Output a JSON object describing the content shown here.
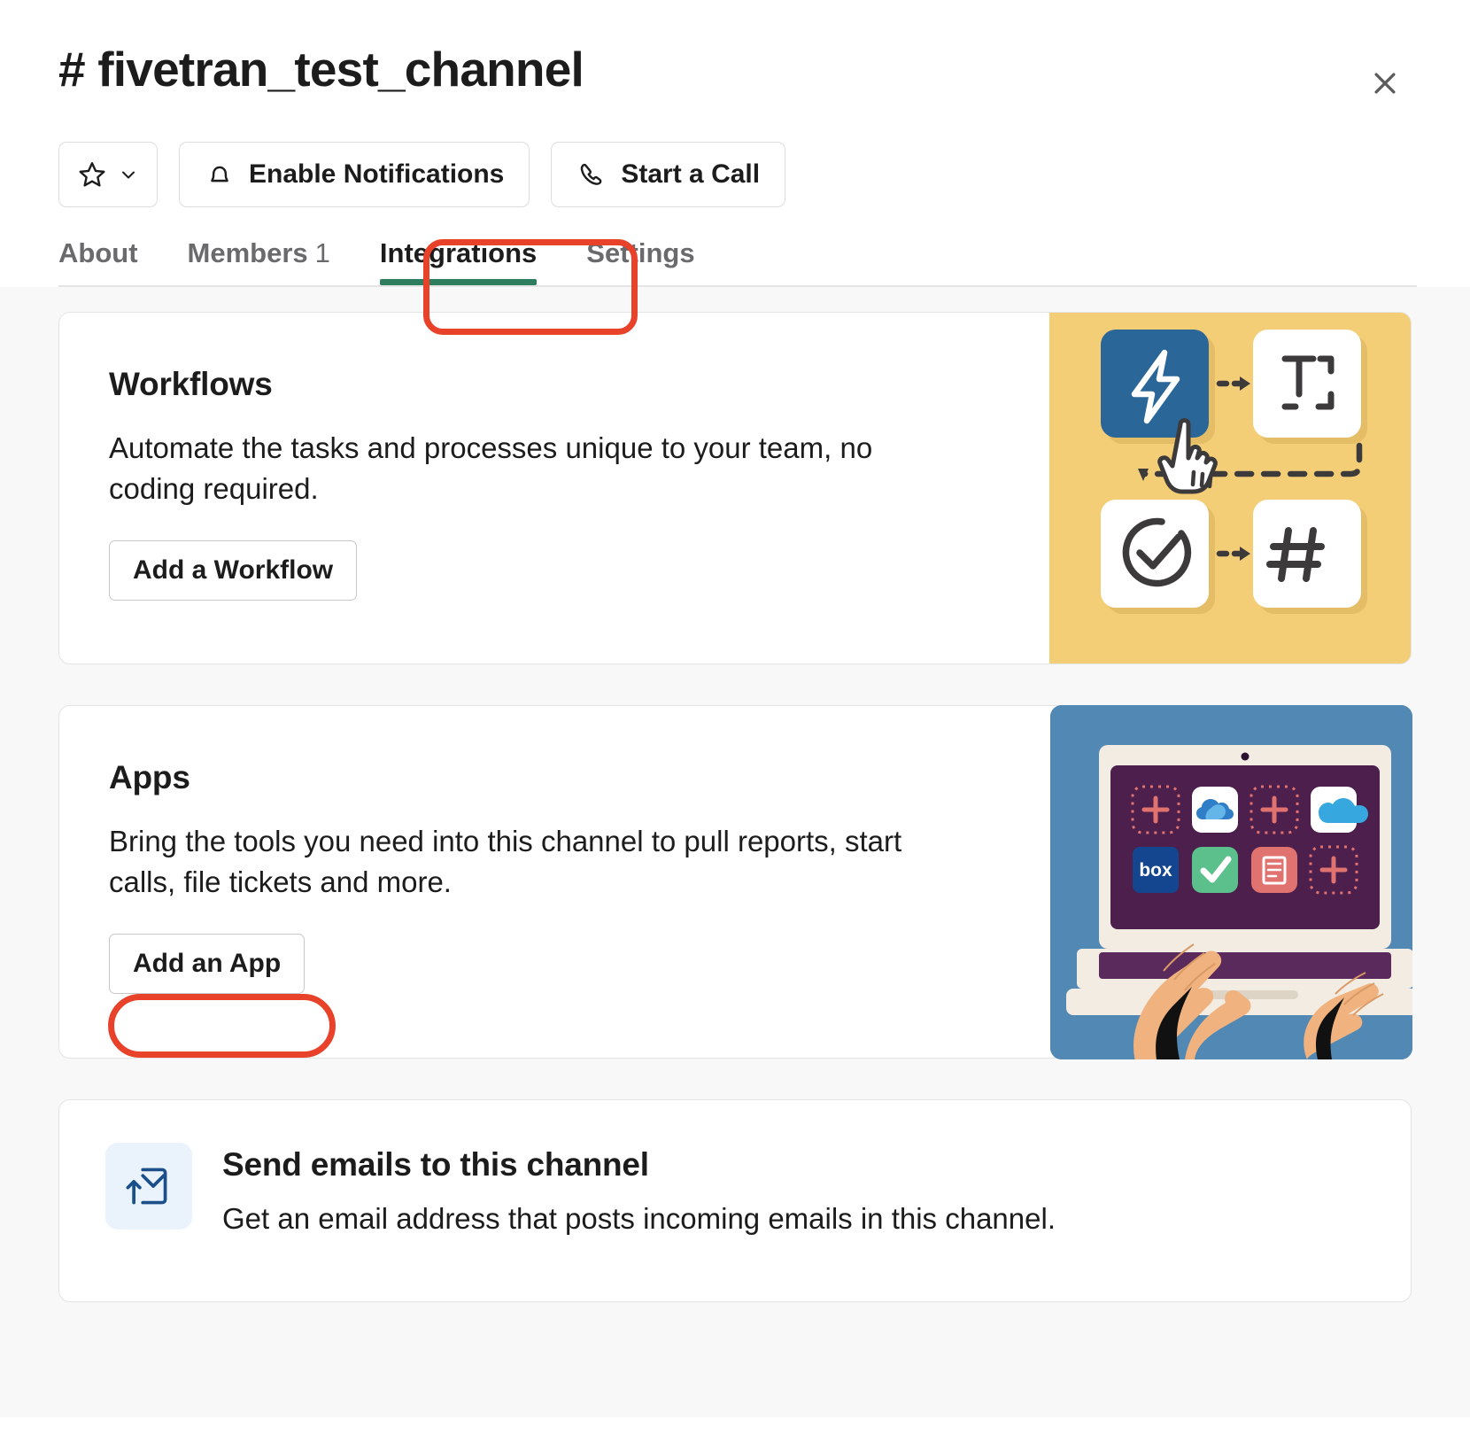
{
  "header": {
    "channel_prefix": "#",
    "channel_name": "fivetran_test_channel",
    "close_icon": "close-icon"
  },
  "actions": [
    {
      "id": "star",
      "label": "",
      "icon": "star-icon",
      "trailing_icon": "chevron-down-icon"
    },
    {
      "id": "notifications",
      "label": "Enable Notifications",
      "icon": "bell-icon"
    },
    {
      "id": "call",
      "label": "Start a Call",
      "icon": "phone-icon"
    }
  ],
  "tabs": [
    {
      "id": "about",
      "label": "About",
      "count": "",
      "active": false
    },
    {
      "id": "members",
      "label": "Members",
      "count": "1",
      "active": false
    },
    {
      "id": "integrations",
      "label": "Integrations",
      "count": "",
      "active": true
    },
    {
      "id": "settings",
      "label": "Settings",
      "count": "",
      "active": false
    }
  ],
  "cards": [
    {
      "id": "workflows",
      "title": "Workflows",
      "description": "Automate the tasks and processes unique to your team, no coding required.",
      "button_label": "Add a Workflow",
      "art": "workflow-builder-illustration"
    },
    {
      "id": "apps",
      "title": "Apps",
      "description": "Bring the tools you need into this channel to pull reports, start calls, file tickets and more.",
      "button_label": "Add an App",
      "art": "laptop-apps-illustration"
    }
  ],
  "email_row": {
    "icon": "email-forward-icon",
    "title": "Send emails to this channel",
    "description": "Get an email address that posts incoming emails in this channel."
  },
  "annotations": [
    {
      "id": "integrations-tab-highlight",
      "color": "#e8422a",
      "shape": "rounded-rect"
    },
    {
      "id": "add-an-app-highlight",
      "color": "#e8422a",
      "shape": "rounded-pill"
    }
  ],
  "colors": {
    "accent_tab_underline": "#2e7d5e",
    "annotation_red": "#e8422a",
    "workflow_art_bg": "#f3ce76",
    "workflow_tile_blue": "#2b6699",
    "apps_art_bg": "#5189b4",
    "laptop_screen": "#4c1f4c",
    "email_icon_bg": "#eaf2fb",
    "body_bg": "#f8f8f8",
    "text_primary": "#1d1c1d",
    "text_muted": "#696a6c"
  }
}
